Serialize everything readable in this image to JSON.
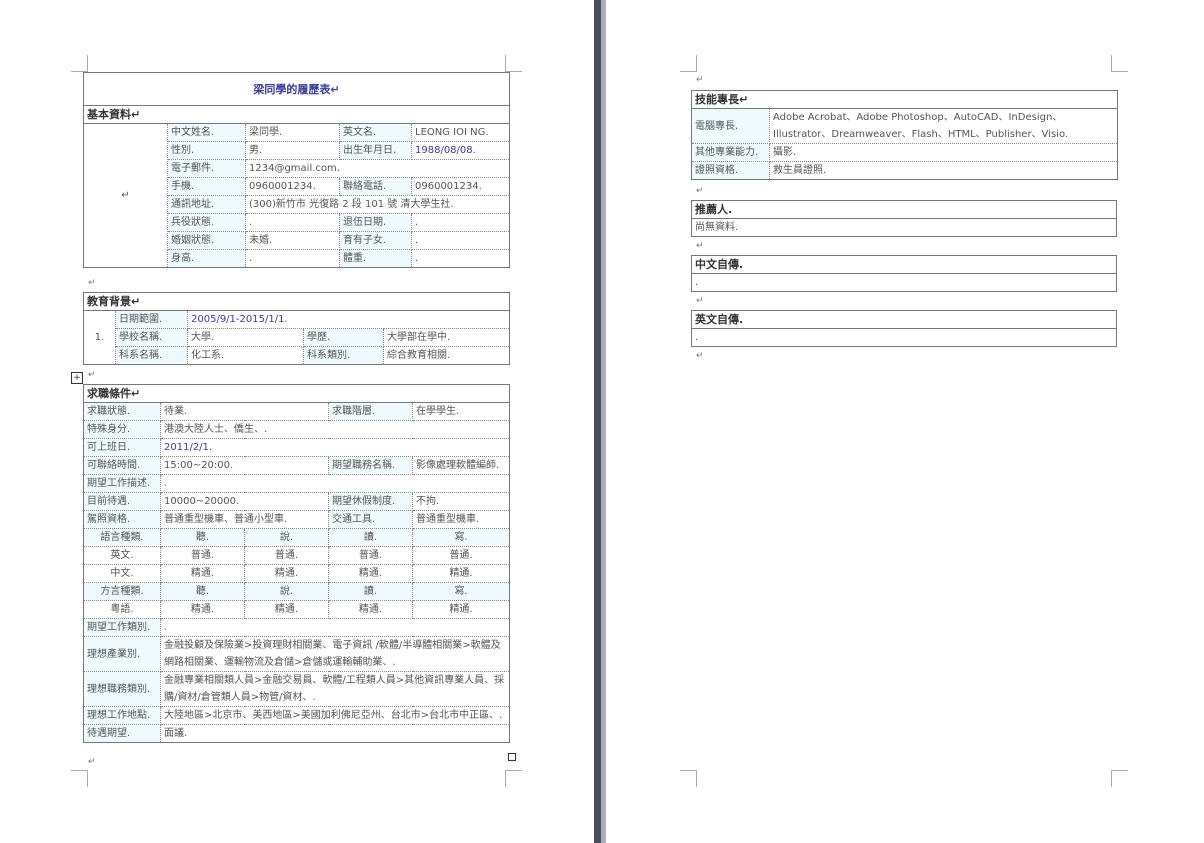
{
  "title": "梁同學的履歷表↵",
  "basic": {
    "heading": "基本資料↵",
    "photo_mark": "↵",
    "rows": [
      [
        "中文姓名.",
        "梁同學.",
        "英文名.",
        "LEONG IOI NG."
      ],
      [
        "性別.",
        "男.",
        "出生年月日.",
        "1988/08/08."
      ],
      [
        "電子郵件.",
        "1234@gmail.com."
      ],
      [
        "手機.",
        "0960001234.",
        "聯絡電話.",
        "0960001234."
      ],
      [
        "通訊地址.",
        "(300)新竹市 光復路 2 段 101 號 清大學生社."
      ],
      [
        "兵役狀態.",
        ".",
        "退伍日期.",
        "."
      ],
      [
        "婚姻狀態.",
        "未婚.",
        "育有子女.",
        "."
      ],
      [
        "身高.",
        ".",
        "體重.",
        "."
      ]
    ]
  },
  "education": {
    "heading": "教育背景↵",
    "index": "1.",
    "date_label": "日期範圍.",
    "date_value": "2005/9/1-2015/1/1.",
    "school_label": "學校名稱.",
    "school_value": "大學.",
    "degree_label": "學歷.",
    "degree_value": "大學部在學中.",
    "dept_label": "科系名稱.",
    "dept_value": "化工系.",
    "cat_label": "科系類別.",
    "cat_value": "綜合教育相關."
  },
  "job": {
    "heading": "求職條件↵",
    "status_label": "求職狀態.",
    "status_value": "待業.",
    "stage_label": "求職階層.",
    "stage_value": "在學學生.",
    "identity_label": "特殊身分.",
    "identity_value": "港澳大陸人士、僑生、.",
    "start_label": "可上班日.",
    "start_value": "2011/2/1.",
    "contact_label": "可聯絡時間.",
    "contact_value": "15:00~20:00.",
    "position_label": "期望職務名稱.",
    "position_value": "影像處理軟體編師.",
    "desc_label": "期望工作描述.",
    "desc_value": ".",
    "salary_label": "目前待遇.",
    "salary_value": "10000~20000.",
    "leave_label": "期望休假制度.",
    "leave_value": "不拘.",
    "license_label": "駕照資格.",
    "license_value": "普通重型機車、普通小型車.",
    "vehicle_label": "交通工具.",
    "vehicle_value": "普通重型機車.",
    "lang_head": [
      "語言種類.",
      "聽.",
      "說.",
      "讀.",
      "寫."
    ],
    "lang_rows": [
      [
        "英文.",
        "普通.",
        "普通.",
        "普通.",
        "普通."
      ],
      [
        "中文.",
        "精通.",
        "精通.",
        "精通.",
        "精通."
      ]
    ],
    "dialect_head": [
      "方言種類.",
      "聽.",
      "說.",
      "讀.",
      "寫."
    ],
    "dialect_rows": [
      [
        "粵語.",
        "精通.",
        "精通.",
        "精通.",
        "精通."
      ]
    ],
    "type_label": "期望工作類別.",
    "type_value": ".",
    "industry_label": "理想產業別.",
    "industry_value": "金融投顧及保險業>投資理財相關業、電子資訊 /軟體/半導體相關業>軟體及網路相關業、運輸物流及倉儲>倉儲或運輸輔助業、.",
    "role_label": "理想職務類別.",
    "role_value": "金融專業相關類人員>金融交易員、軟體/工程類人員>其他資訊專業人員、採購/資材/倉管類人員>物管/資材、.",
    "place_label": "理想工作地點.",
    "place_value": "大陸地區>北京市、美西地區>美國加利佛尼亞州、台北市>台北市中正區、.",
    "pay_label": "待遇期望.",
    "pay_value": "面議."
  },
  "skills": {
    "heading": "技能專長↵",
    "computer_label": "電腦專長.",
    "computer_value": "Adobe Acrobat、Adobe Photoshop、AutoCAD、InDesign、Illustrator、Dreamweaver、Flash、HTML、Publisher、Visio.",
    "other_label": "其他專業能力.",
    "other_value": "攝影.",
    "cert_label": "證照資格.",
    "cert_value": "救生員證照."
  },
  "referee": {
    "heading": "推薦人.",
    "value": "尚無資料."
  },
  "cn_bio": {
    "heading": "中文自傳.",
    "value": "."
  },
  "en_bio": {
    "heading": "英文自傳.",
    "value": "."
  },
  "marks": {
    "return": "↵",
    "anchor": "+"
  }
}
